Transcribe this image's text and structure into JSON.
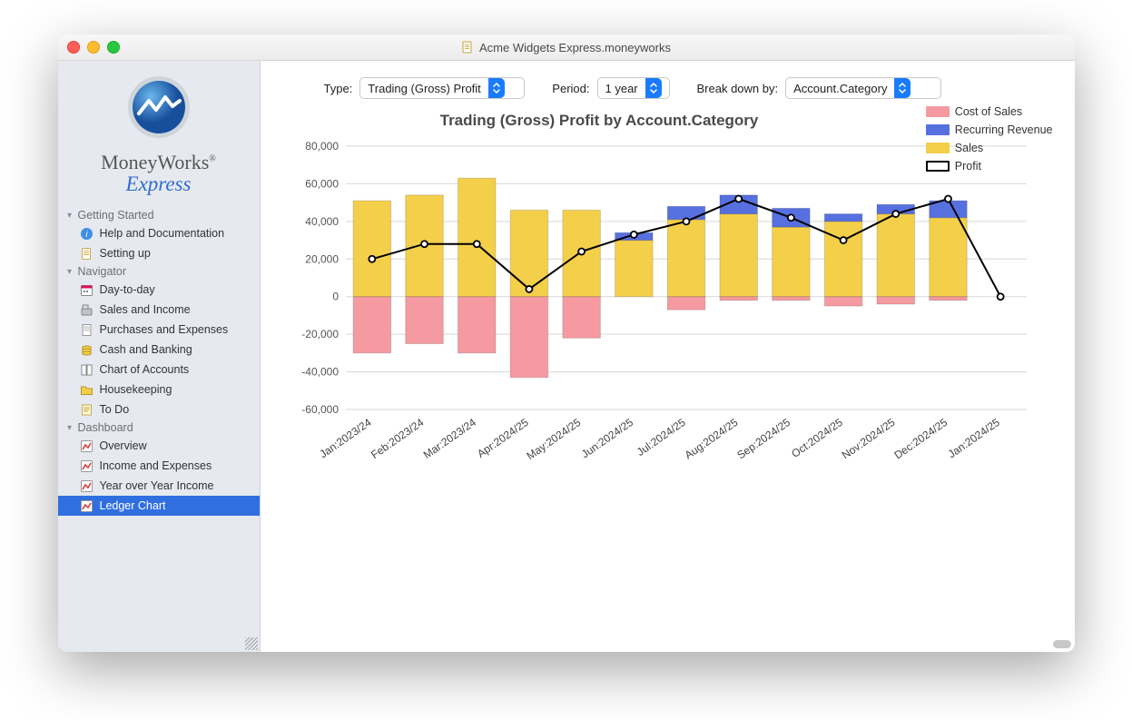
{
  "window_title": "Acme Widgets Express.moneyworks",
  "brand": {
    "name": "MoneyWorks",
    "sub": "Express"
  },
  "sidebar": {
    "groups": [
      {
        "label": "Getting Started",
        "items": [
          {
            "label": "Help and Documentation",
            "icon": "info-icon"
          },
          {
            "label": "Setting up",
            "icon": "doc-icon"
          }
        ]
      },
      {
        "label": "Navigator",
        "items": [
          {
            "label": "Day-to-day",
            "icon": "calendar-icon"
          },
          {
            "label": "Sales and Income",
            "icon": "cashreg-icon"
          },
          {
            "label": "Purchases and Expenses",
            "icon": "receipt-icon"
          },
          {
            "label": "Cash and Banking",
            "icon": "coins-icon"
          },
          {
            "label": "Chart of Accounts",
            "icon": "book-icon"
          },
          {
            "label": "Housekeeping",
            "icon": "folder-icon"
          },
          {
            "label": "To Do",
            "icon": "note-icon"
          }
        ]
      },
      {
        "label": "Dashboard",
        "items": [
          {
            "label": "Overview",
            "icon": "chart-icon"
          },
          {
            "label": "Income and Expenses",
            "icon": "chart-icon"
          },
          {
            "label": "Year over Year Income",
            "icon": "chart-icon"
          },
          {
            "label": "Ledger Chart",
            "icon": "chart-icon",
            "selected": true
          }
        ]
      }
    ]
  },
  "controls": {
    "type_label": "Type:",
    "type_value": "Trading (Gross) Profit",
    "period_label": "Period:",
    "period_value": "1 year",
    "breakdown_label": "Break down by:",
    "breakdown_value": "Account.Category"
  },
  "chart_data": {
    "type": "bar+line",
    "title": "Trading (Gross) Profit by Account.Category",
    "ylabel": "",
    "xlabel": "",
    "ylim": [
      -60000,
      80000
    ],
    "yticks": [
      -60000,
      -40000,
      -20000,
      0,
      20000,
      40000,
      60000,
      80000
    ],
    "ytick_labels": [
      "-60,000",
      "-40,000",
      "-20,000",
      "0",
      "20,000",
      "40,000",
      "60,000",
      "80,000"
    ],
    "categories": [
      "Jan:2023/24",
      "Feb:2023/24",
      "Mar:2023/24",
      "Apr:2024/25",
      "May:2024/25",
      "Jun:2024/25",
      "Jul:2024/25",
      "Aug:2024/25",
      "Sep:2024/25",
      "Oct:2024/25",
      "Nov:2024/25",
      "Dec:2024/25",
      "Jan:2024/25"
    ],
    "series": [
      {
        "name": "Sales",
        "color": "#f4cf4a",
        "stack": "pos",
        "values": [
          51000,
          54000,
          63000,
          46000,
          46000,
          30000,
          41000,
          44000,
          37000,
          40000,
          44000,
          42000,
          0
        ]
      },
      {
        "name": "Recurring Revenue",
        "color": "#5670e0",
        "stack": "pos",
        "values": [
          0,
          0,
          0,
          0,
          0,
          4000,
          7000,
          10000,
          10000,
          4000,
          5000,
          9000,
          0
        ]
      },
      {
        "name": "Cost of Sales",
        "color": "#f59aa0",
        "stack": "neg",
        "values": [
          -30000,
          -25000,
          -30000,
          -43000,
          -22000,
          0,
          -7000,
          -2000,
          -2000,
          -5000,
          -4000,
          -2000,
          0
        ]
      }
    ],
    "line_series": {
      "name": "Profit",
      "color": "#000000",
      "values": [
        20000,
        28000,
        28000,
        4000,
        24000,
        33000,
        40000,
        52000,
        42000,
        30000,
        44000,
        52000,
        0
      ]
    },
    "legend": [
      {
        "name": "Cost of Sales",
        "color": "#f59aa0",
        "type": "fill"
      },
      {
        "name": "Recurring Revenue",
        "color": "#5670e0",
        "type": "fill"
      },
      {
        "name": "Sales",
        "color": "#f4cf4a",
        "type": "fill"
      },
      {
        "name": "Profit",
        "color": "#000000",
        "type": "line"
      }
    ]
  }
}
